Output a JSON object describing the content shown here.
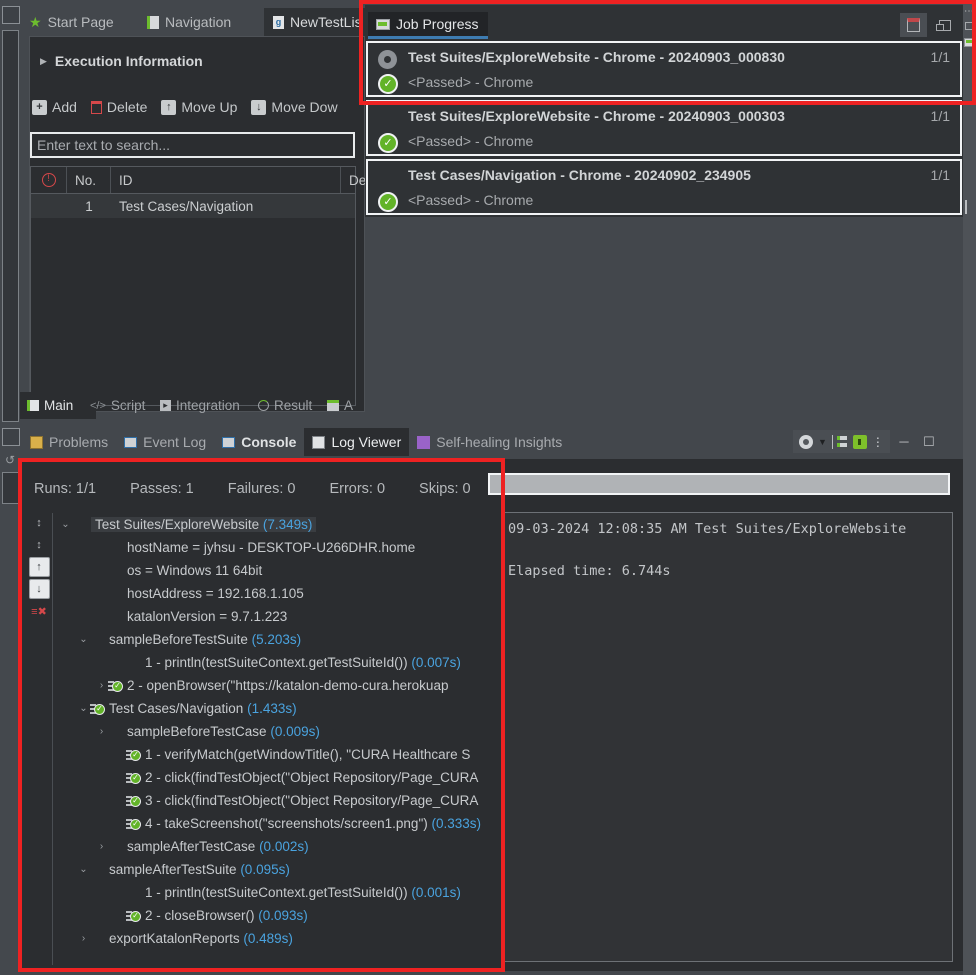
{
  "app": {
    "theme_accent": "#3e7cb1",
    "annotation_color": "#ee2222",
    "pass_color": "#62b328",
    "duration_color": "#4aa3df"
  },
  "editor": {
    "tabs": [
      {
        "label": "Start Page",
        "icon": "star-icon",
        "active": false
      },
      {
        "label": "Navigation",
        "icon": "test-case-icon",
        "active": false
      },
      {
        "label": "NewTestLis",
        "icon": "test-listener-icon",
        "active": true
      }
    ],
    "section_header": "Execution Information",
    "toolbar": [
      {
        "label": "Add",
        "icon": "plus-icon"
      },
      {
        "label": "Delete",
        "icon": "trash-icon"
      },
      {
        "label": "Move Up",
        "icon": "arrow-up-icon"
      },
      {
        "label": "Move Dow",
        "icon": "arrow-down-icon"
      }
    ],
    "search_placeholder": "Enter text to search...",
    "table": {
      "columns": [
        "",
        "No.",
        "ID",
        "De"
      ],
      "rows": [
        {
          "no": "1",
          "id": "Test Cases/Navigation",
          "desc": ""
        }
      ]
    },
    "sub_tabs": [
      {
        "label": "Main",
        "icon": "main-icon",
        "active": true
      },
      {
        "label": "Script",
        "icon": "code-icon",
        "active": false
      },
      {
        "label": "Integration",
        "icon": "integration-icon",
        "active": false
      },
      {
        "label": "Result",
        "icon": "result-icon",
        "active": false
      },
      {
        "label": "A",
        "icon": "analytics-icon",
        "active": false
      }
    ]
  },
  "job_progress": {
    "title": "Job Progress",
    "tab_icon": "job-progress-icon",
    "tools": [
      {
        "name": "clear-jobs-icon",
        "glyph": "clear"
      },
      {
        "name": "restore-panel-icon",
        "glyph": "restore"
      }
    ],
    "jobs": [
      {
        "name": "Test Suites/ExploreWebsite - Chrome - 20240903_000830",
        "count": "1/1",
        "status": "<Passed> - Chrome",
        "lead_icon": "running-indicator-icon",
        "selected": true
      },
      {
        "name": "Test Suites/ExploreWebsite - Chrome - 20240903_000303",
        "count": "1/1",
        "status": "<Passed> - Chrome",
        "lead_icon": "none",
        "selected": false
      },
      {
        "name": "Test Cases/Navigation - Chrome - 20240902_234905",
        "count": "1/1",
        "status": "<Passed> - Chrome",
        "lead_icon": "none",
        "selected": false
      }
    ]
  },
  "dock": {
    "tabs": [
      {
        "label": "Problems",
        "icon": "problems-icon",
        "state": "normal"
      },
      {
        "label": "Event Log",
        "icon": "event-log-icon",
        "state": "normal"
      },
      {
        "label": "Console",
        "icon": "console-icon",
        "state": "bold"
      },
      {
        "label": "Log Viewer",
        "icon": "log-viewer-icon",
        "state": "active"
      },
      {
        "label": "Self-healing Insights",
        "icon": "self-healing-icon",
        "state": "normal"
      }
    ],
    "tools": [
      {
        "name": "view-menu-icon"
      },
      {
        "name": "chevron-down-icon"
      },
      {
        "name": "tree-layout-icon"
      },
      {
        "name": "lock-icon"
      },
      {
        "name": "overflow-menu-icon"
      },
      {
        "name": "minimize-icon"
      },
      {
        "name": "maximize-icon"
      }
    ]
  },
  "log_viewer": {
    "stats": [
      {
        "label": "Runs:",
        "value": "1/1"
      },
      {
        "label": "Passes:",
        "value": "1"
      },
      {
        "label": "Failures:",
        "value": "0"
      },
      {
        "label": "Errors:",
        "value": "0"
      },
      {
        "label": "Skips:",
        "value": "0"
      }
    ],
    "progress_percent": 100,
    "side_tools": [
      {
        "name": "collapse-all-icon",
        "glyph": "collapse"
      },
      {
        "name": "expand-all-icon",
        "glyph": "expand"
      },
      {
        "name": "previous-icon",
        "glyph": "up"
      },
      {
        "name": "next-icon",
        "glyph": "down"
      },
      {
        "name": "clear-log-icon",
        "glyph": "clear"
      }
    ],
    "tree": [
      {
        "indent": 0,
        "twisty": "open",
        "icon": "none",
        "text": "Test Suites/ExploreWebsite",
        "duration": "(7.349s)",
        "highlight": true
      },
      {
        "indent": 2,
        "twisty": "none",
        "icon": "none",
        "text": "hostName = jyhsu - DESKTOP-U266DHR.home",
        "duration": ""
      },
      {
        "indent": 2,
        "twisty": "none",
        "icon": "none",
        "text": "os = Windows 11 64bit",
        "duration": ""
      },
      {
        "indent": 2,
        "twisty": "none",
        "icon": "none",
        "text": "hostAddress = 192.168.1.105",
        "duration": ""
      },
      {
        "indent": 2,
        "twisty": "none",
        "icon": "none",
        "text": "katalonVersion = 9.7.1.223",
        "duration": ""
      },
      {
        "indent": 1,
        "twisty": "open",
        "icon": "none",
        "text": "sampleBeforeTestSuite",
        "duration": "(5.203s)"
      },
      {
        "indent": 3,
        "twisty": "none",
        "icon": "none",
        "text": "1 - println(testSuiteContext.getTestSuiteId())",
        "duration": "(0.007s)"
      },
      {
        "indent": 2,
        "twisty": "closed",
        "icon": "pass",
        "text": "2 - openBrowser(\"https://katalon-demo-cura.herokuap",
        "duration": ""
      },
      {
        "indent": 1,
        "twisty": "open",
        "icon": "pass",
        "text": "Test Cases/Navigation",
        "duration": "(1.433s)"
      },
      {
        "indent": 2,
        "twisty": "closed",
        "icon": "none",
        "text": "sampleBeforeTestCase",
        "duration": "(0.009s)"
      },
      {
        "indent": 3,
        "twisty": "none",
        "icon": "pass",
        "text": "1 - verifyMatch(getWindowTitle(), \"CURA Healthcare S",
        "duration": ""
      },
      {
        "indent": 3,
        "twisty": "none",
        "icon": "pass",
        "text": "2 - click(findTestObject(\"Object Repository/Page_CURA",
        "duration": ""
      },
      {
        "indent": 3,
        "twisty": "none",
        "icon": "pass",
        "text": "3 - click(findTestObject(\"Object Repository/Page_CURA",
        "duration": ""
      },
      {
        "indent": 3,
        "twisty": "none",
        "icon": "pass",
        "text": "4 - takeScreenshot(\"screenshots/screen1.png\")",
        "duration": "(0.333s)"
      },
      {
        "indent": 2,
        "twisty": "closed",
        "icon": "none",
        "text": "sampleAfterTestCase",
        "duration": "(0.002s)"
      },
      {
        "indent": 1,
        "twisty": "open",
        "icon": "none",
        "text": "sampleAfterTestSuite",
        "duration": "(0.095s)"
      },
      {
        "indent": 3,
        "twisty": "none",
        "icon": "none",
        "text": "1 - println(testSuiteContext.getTestSuiteId())",
        "duration": "(0.001s)"
      },
      {
        "indent": 3,
        "twisty": "none",
        "icon": "pass",
        "text": "2 - closeBrowser()",
        "duration": "(0.093s)"
      },
      {
        "indent": 1,
        "twisty": "closed",
        "icon": "none",
        "text": "exportKatalonReports",
        "duration": "(0.489s)"
      }
    ],
    "console_lines": [
      "09-03-2024 12:08:35 AM Test Suites/ExploreWebsite",
      "",
      "Elapsed time: 6.744s"
    ]
  }
}
